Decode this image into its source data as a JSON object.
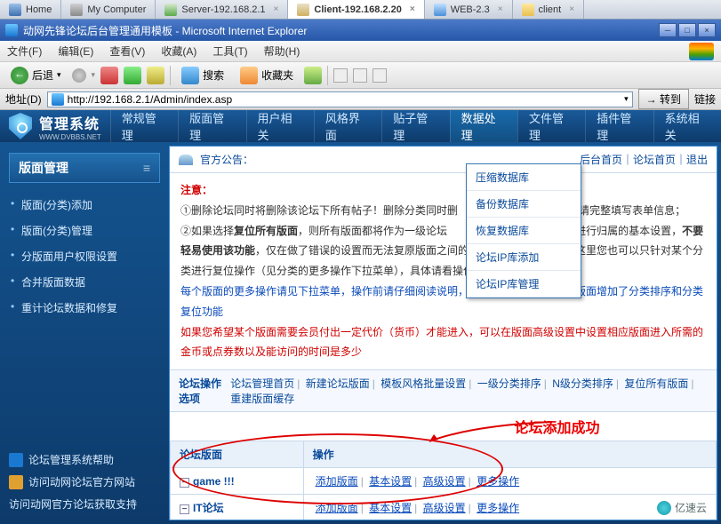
{
  "os_tabs": [
    {
      "label": "Home",
      "icon": "home"
    },
    {
      "label": "My Computer",
      "icon": "computer"
    },
    {
      "label": "Server-192.168.2.1",
      "icon": "server"
    },
    {
      "label": "Client-192.168.2.20",
      "icon": "client",
      "active": true
    },
    {
      "label": "WEB-2.3",
      "icon": "web"
    },
    {
      "label": "client",
      "icon": "folder"
    }
  ],
  "ie": {
    "title": "动网先锋论坛后台管理通用模板 - Microsoft Internet Explorer",
    "menu": [
      "文件(F)",
      "编辑(E)",
      "查看(V)",
      "收藏(A)",
      "工具(T)",
      "帮助(H)"
    ],
    "toolbar": {
      "back": "后退",
      "search": "搜索",
      "fav": "收藏夹"
    },
    "addr_label": "地址(D)",
    "url": "http://192.168.2.1/Admin/index.asp",
    "go": "转到",
    "links": "链接"
  },
  "admin": {
    "logo": "管理系统",
    "logo_sub": "WWW.DVBBS.NET",
    "nav": [
      "常规管理",
      "版面管理",
      "用户相关",
      "风格界面",
      "贴子管理",
      "数据处理",
      "文件管理",
      "插件管理",
      "系统相关"
    ],
    "nav_active": 5
  },
  "dropdown": [
    "压缩数据库",
    "备份数据库",
    "恢复数据库",
    "论坛IP库添加",
    "论坛IP库管理"
  ],
  "sidebar": {
    "title": "版面管理",
    "items": [
      "版面(分类)添加",
      "版面(分类)管理",
      "分版面用户权限设置",
      "合并版面数据",
      "重计论坛数据和修复"
    ],
    "bottom": [
      {
        "label": "论坛管理系统帮助",
        "color": "#1a78d0"
      },
      {
        "label": "访问动网论坛官方网站",
        "color": "#e0a030"
      },
      {
        "label": "访问动网官方论坛获取支持",
        "color": ""
      }
    ]
  },
  "content": {
    "announce": "官方公告：",
    "top_links": "后台首页｜论坛首页｜退出",
    "note_h": "注意：",
    "p1": "①删除论坛同时将删除该论坛下所有帖子！删除分类同时删",
    "p1b": "作时请完整填写表单信息；",
    "p2a": "②如果选择",
    "p2b": "复位所有版面",
    "p2c": "，则所有版面都将作为一级论坛",
    "p2d": "各个版面进行归属的基本设置，",
    "p2e": "不要轻易使用该功能",
    "p2f": "，仅在做了错误的设置而无法复原版面之间的关系和排序时使用，在这里您也可以只针对某个分类进行复位操作（见分类的更多操作下拉菜单），具体请看操作说明。",
    "p3": "每个版面的更多操作请见下拉菜单，操作前请仔细阅读说明，分类下拉菜单中比别的版面增加了分类排序和分类复位功能",
    "p4": "如果您希望某个版面需要会员付出一定代价（货币）才能进入，可以在版面高级设置中设置相应版面进入所需的金币或点券数以及能访问的时间是多少",
    "ops_h": "论坛操作选项",
    "ops": [
      "论坛管理首页",
      "新建论坛版面",
      "模板风格批量设置",
      "一级分类排序",
      "N级分类排序",
      "复位所有版面",
      "重建版面缓存"
    ],
    "success": "论坛添加成功",
    "table": {
      "h1": "论坛版面",
      "h2": "操作",
      "rows": [
        {
          "name": "game !!!"
        },
        {
          "name": "IT论坛"
        }
      ],
      "actions": [
        "添加版面",
        "基本设置",
        "高级设置",
        "更多操作"
      ]
    }
  },
  "watermark": "亿速云"
}
